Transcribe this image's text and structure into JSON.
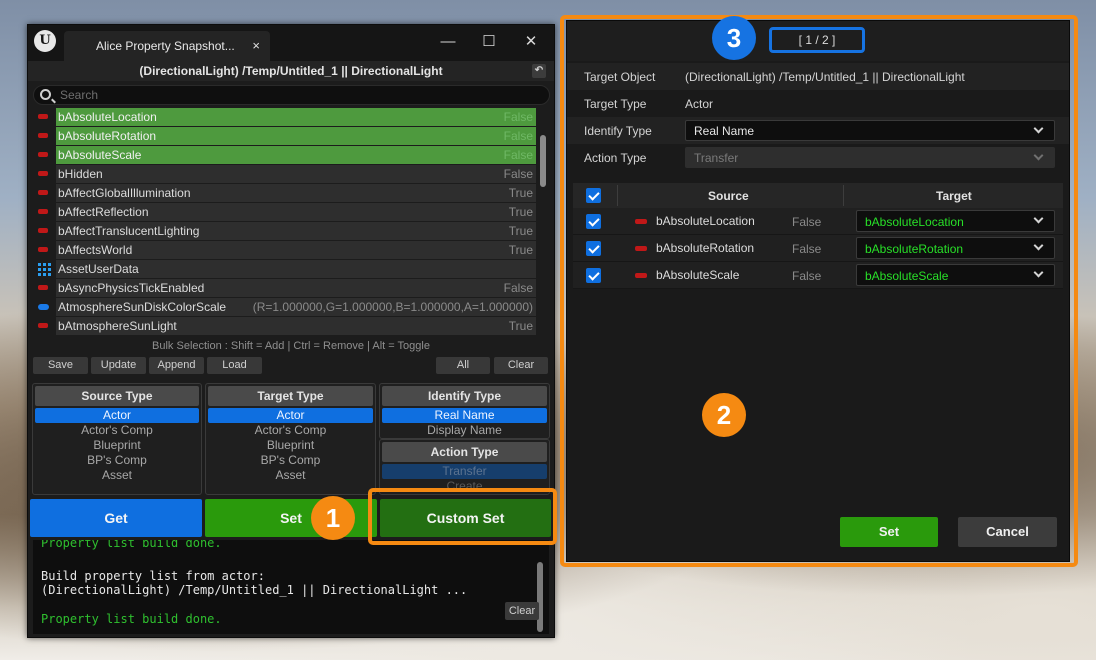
{
  "window": {
    "logo_text": "U",
    "tab_title": "Alice Property Snapshot...",
    "tab_close": "×",
    "minimize": "—",
    "maximize": "☐",
    "close": "✕",
    "object_path": "(DirectionalLight) /Temp/Untitled_1 || DirectionalLight",
    "reset_icon": "↶"
  },
  "search": {
    "placeholder": "Search"
  },
  "properties": [
    {
      "name": "bAbsoluteLocation",
      "value": "False",
      "selected": true,
      "icon": "bool-pin-icon"
    },
    {
      "name": "bAbsoluteRotation",
      "value": "False",
      "selected": true,
      "icon": "bool-pin-icon"
    },
    {
      "name": "bAbsoluteScale",
      "value": "False",
      "selected": true,
      "icon": "bool-pin-icon"
    },
    {
      "name": "bHidden",
      "value": "False",
      "selected": false,
      "icon": "bool-pin-icon"
    },
    {
      "name": "bAffectGlobalIllumination",
      "value": "True",
      "selected": false,
      "icon": "bool-pin-icon"
    },
    {
      "name": "bAffectReflection",
      "value": "True",
      "selected": false,
      "icon": "bool-pin-icon"
    },
    {
      "name": "bAffectTranslucentLighting",
      "value": "True",
      "selected": false,
      "icon": "bool-pin-icon"
    },
    {
      "name": "bAffectsWorld",
      "value": "True",
      "selected": false,
      "icon": "bool-pin-icon"
    },
    {
      "name": "AssetUserData",
      "value": "",
      "selected": false,
      "icon": "array-grid-icon"
    },
    {
      "name": "bAsyncPhysicsTickEnabled",
      "value": "False",
      "selected": false,
      "icon": "bool-pin-icon"
    },
    {
      "name": "AtmosphereSunDiskColorScale",
      "value": "(R=1.000000,G=1.000000,B=1.000000,A=1.000000)",
      "selected": false,
      "icon": "struct-pin-icon"
    },
    {
      "name": "bAtmosphereSunLight",
      "value": "True",
      "selected": false,
      "icon": "bool-pin-icon"
    }
  ],
  "bulk_hint": "Bulk Selection : Shift = Add | Ctrl = Remove | Alt = Toggle",
  "list_buttons": {
    "save": "Save",
    "update": "Update",
    "append": "Append",
    "load": "Load",
    "all": "All",
    "clear": "Clear"
  },
  "source_type": {
    "title": "Source Type",
    "options": [
      "Actor",
      "Actor's Comp",
      "Blueprint",
      "BP's Comp",
      "Asset"
    ],
    "selected": "Actor"
  },
  "target_type": {
    "title": "Target Type",
    "options": [
      "Actor",
      "Actor's Comp",
      "Blueprint",
      "BP's Comp",
      "Asset"
    ],
    "selected": "Actor"
  },
  "identify_type": {
    "title": "Identify Type",
    "options": [
      "Real Name",
      "Display Name"
    ],
    "selected": "Real Name"
  },
  "action_type": {
    "title": "Action Type",
    "options": [
      "Transfer",
      "Create"
    ],
    "selected": "Transfer"
  },
  "actions": {
    "get": "Get",
    "set": "Set",
    "custom_set": "Custom Set"
  },
  "log": {
    "lines": [
      "Property list build done.",
      "Build property list from actor:",
      "(DirectionalLight) /Temp/Untitled_1 || DirectionalLight ...",
      "Property list build done."
    ],
    "clear": "Clear"
  },
  "dialog": {
    "pager": "[ 1 / 2 ]",
    "target_object_label": "Target Object",
    "target_object_value": "(DirectionalLight) /Temp/Untitled_1 || DirectionalLight",
    "target_type_label": "Target Type",
    "target_type_value": "Actor",
    "identify_type_label": "Identify Type",
    "identify_type_value": "Real Name",
    "action_type_label": "Action Type",
    "action_type_value": "Transfer",
    "col_source": "Source",
    "col_target": "Target",
    "rows": [
      {
        "source": "bAbsoluteLocation",
        "value": "False",
        "target": "bAbsoluteLocation",
        "checked": true
      },
      {
        "source": "bAbsoluteRotation",
        "value": "False",
        "target": "bAbsoluteRotation",
        "checked": true
      },
      {
        "source": "bAbsoluteScale",
        "value": "False",
        "target": "bAbsoluteScale",
        "checked": true
      }
    ],
    "set": "Set",
    "cancel": "Cancel"
  },
  "annotations": {
    "badge1": "1",
    "badge2": "2",
    "badge3": "3"
  },
  "colors": {
    "highlight_orange": "#f58a12",
    "badge_orange": "#f58a12",
    "badge_blue": "#1673e2",
    "get_blue": "#0f6fe0",
    "set_green": "#2a9a0c",
    "custom_set_green": "#236f12",
    "selected_row_green": "#4e9a3e",
    "target_text_green": "#28e028"
  }
}
